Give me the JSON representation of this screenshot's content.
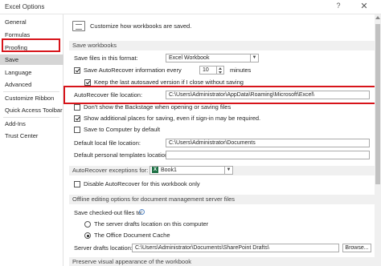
{
  "window": {
    "title": "Excel Options",
    "help_glyph": "?",
    "close_glyph": "✕"
  },
  "sidebar": {
    "items": [
      {
        "label": "General"
      },
      {
        "label": "Formulas"
      },
      {
        "label": "Proofing"
      },
      {
        "label": "Save"
      },
      {
        "label": "Language"
      },
      {
        "label": "Advanced"
      },
      {
        "label": "Customize Ribbon"
      },
      {
        "label": "Quick Access Toolbar"
      },
      {
        "label": "Add-Ins"
      },
      {
        "label": "Trust Center"
      }
    ],
    "active": "Save"
  },
  "header": {
    "text": "Customize how workbooks are saved."
  },
  "save_workbooks": {
    "section_title": "Save workbooks",
    "format_label": "Save files in this format:",
    "format_value": "Excel Workbook",
    "autorecover_label": "Save AutoRecover information every",
    "autorecover_checked": true,
    "autorecover_minutes": "10",
    "minutes_label": "minutes",
    "keep_last_label": "Keep the last autosaved version if I close without saving",
    "keep_last_checked": true,
    "autorecover_location_label": "AutoRecover file location:",
    "autorecover_location_value": "C:\\Users\\Administrator\\AppData\\Roaming\\Microsoft\\Excel\\",
    "backstage_label": "Don't show the Backstage when opening or saving files",
    "backstage_checked": false,
    "show_places_label": "Show additional places for saving, even if sign-in may be required.",
    "show_places_checked": true,
    "save_computer_label": "Save to Computer by default",
    "save_computer_checked": false,
    "default_local_label": "Default local file location:",
    "default_local_value": "C:\\Users\\Administrator\\Documents",
    "default_templates_label": "Default personal templates location:",
    "default_templates_value": ""
  },
  "autorecover_exceptions": {
    "section_label": "AutoRecover exceptions for:",
    "workbook_value": "Book1",
    "disable_label": "Disable AutoRecover for this workbook only",
    "disable_checked": false
  },
  "offline": {
    "section_title": "Offline editing options for document management server files",
    "save_checked_out_label": "Save checked-out files to:",
    "info_glyph": "i",
    "option_server_label": "The server drafts location on this computer",
    "option_server_checked": false,
    "option_cache_label": "The Office Document Cache",
    "option_cache_checked": true,
    "server_drafts_label": "Server drafts location:",
    "server_drafts_value": "C:\\Users\\Administrator\\Documents\\SharePoint Drafts\\",
    "browse_label": "Browse..."
  },
  "visual": {
    "section_title": "Preserve visual appearance of the workbook"
  },
  "colors": {
    "highlight_red": "#d7141a",
    "active_nav": "#d5d5d5",
    "section_bg": "#f0f0f0",
    "excel_green": "#1e7145"
  },
  "icons": [
    "document-icon",
    "excel-icon",
    "info-icon",
    "close-icon",
    "help-icon",
    "dropdown-arrow-icon"
  ]
}
